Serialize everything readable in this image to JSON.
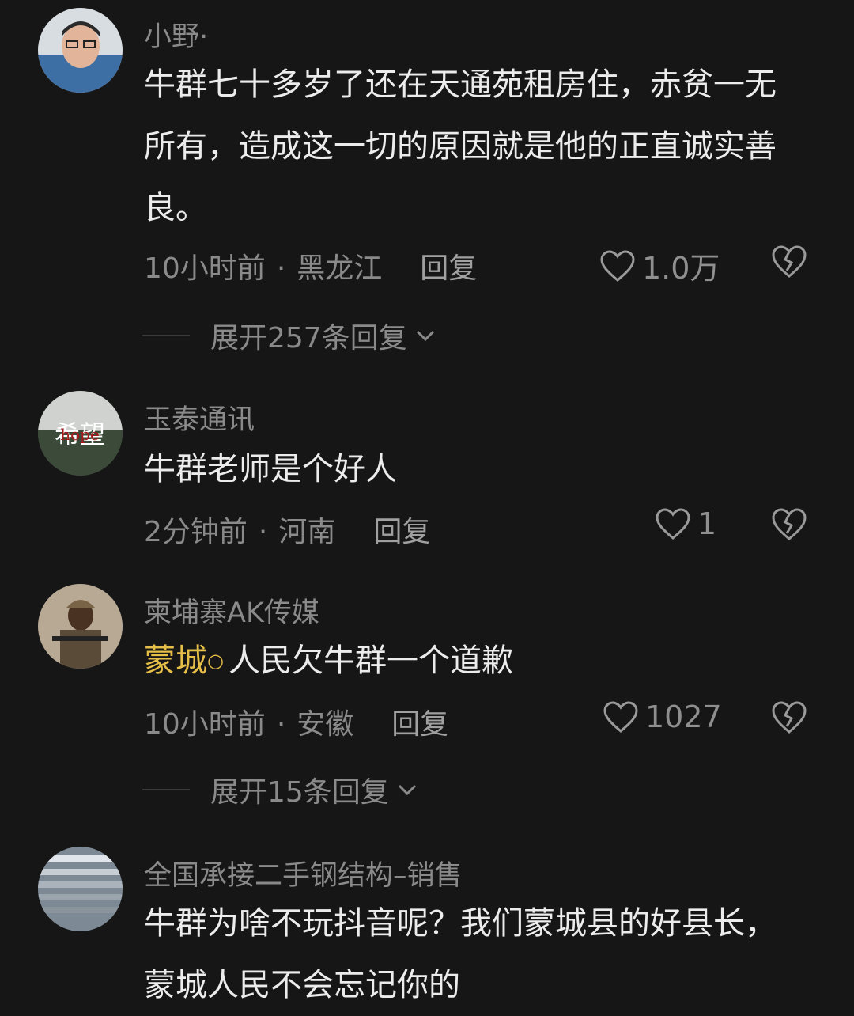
{
  "comments": [
    {
      "username": "小野·",
      "text": "牛群七十多岁了还在天通苑租房住，赤贫一无所有，造成这一切的原因就是他的正直诚实善良。",
      "time": "10小时前",
      "location": "黑龙江",
      "reply_label": "回复",
      "likes": "1.0万",
      "expand_label": "展开257条回复"
    },
    {
      "username": "玉泰通讯",
      "text": "牛群老师是个好人",
      "time": "2分钟前",
      "location": "河南",
      "reply_label": "回复",
      "likes": "1"
    },
    {
      "username": "柬埔寨AK传媒",
      "tag": "蒙城",
      "text": "人民欠牛群一个道歉",
      "time": "10小时前",
      "location": "安徽",
      "reply_label": "回复",
      "likes": "1027",
      "expand_label": "展开15条回复"
    },
    {
      "username": "全国承接二手钢结构–销售",
      "text": "牛群为啥不玩抖音呢？我们蒙城县的好县长，蒙城人民不会忘记你的"
    }
  ],
  "colors": {
    "background": "#161616",
    "tag": "#e6bf48",
    "muted": "#8a8a8a"
  }
}
